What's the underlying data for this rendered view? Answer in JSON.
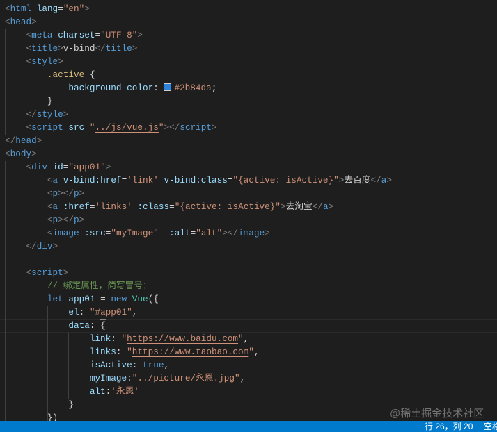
{
  "editor": {
    "current_line": 25,
    "color_swatch": "#2b84da",
    "lines": [
      [
        [
          "p",
          "<"
        ],
        [
          "t",
          "html"
        ],
        [
          "tx",
          " "
        ],
        [
          "a",
          "lang"
        ],
        [
          "tx",
          "="
        ],
        [
          "s",
          "\"en\""
        ],
        [
          "p",
          ">"
        ]
      ],
      [
        [
          "p",
          "<"
        ],
        [
          "t",
          "head"
        ],
        [
          "p",
          ">"
        ]
      ],
      [
        [
          "tx",
          "    "
        ],
        [
          "p",
          "<"
        ],
        [
          "t",
          "meta"
        ],
        [
          "tx",
          " "
        ],
        [
          "a",
          "charset"
        ],
        [
          "tx",
          "="
        ],
        [
          "s",
          "\"UTF-8\""
        ],
        [
          "p",
          ">"
        ]
      ],
      [
        [
          "tx",
          "    "
        ],
        [
          "p",
          "<"
        ],
        [
          "t",
          "title"
        ],
        [
          "p",
          ">"
        ],
        [
          "tx",
          "v-bind"
        ],
        [
          "p",
          "</"
        ],
        [
          "t",
          "title"
        ],
        [
          "p",
          ">"
        ]
      ],
      [
        [
          "tx",
          "    "
        ],
        [
          "p",
          "<"
        ],
        [
          "t",
          "style"
        ],
        [
          "p",
          ">"
        ]
      ],
      [
        [
          "tx",
          "        "
        ],
        [
          "sel",
          ".active"
        ],
        [
          "tx",
          " {"
        ]
      ],
      [
        [
          "tx",
          "            "
        ],
        [
          "a",
          "background-color"
        ],
        [
          "tx",
          ": "
        ],
        [
          "sw",
          ""
        ],
        [
          "s",
          "#2b84da"
        ],
        [
          "tx",
          ";"
        ]
      ],
      [
        [
          "tx",
          "        }"
        ]
      ],
      [
        [
          "tx",
          "    "
        ],
        [
          "p",
          "</"
        ],
        [
          "t",
          "style"
        ],
        [
          "p",
          ">"
        ]
      ],
      [
        [
          "tx",
          "    "
        ],
        [
          "p",
          "<"
        ],
        [
          "t",
          "script"
        ],
        [
          "tx",
          " "
        ],
        [
          "a",
          "src"
        ],
        [
          "tx",
          "="
        ],
        [
          "s",
          "\""
        ],
        [
          "u",
          "../js/vue.js"
        ],
        [
          "s",
          "\""
        ],
        [
          "p",
          "></"
        ],
        [
          "t",
          "script"
        ],
        [
          "p",
          ">"
        ]
      ],
      [
        [
          "p",
          "</"
        ],
        [
          "t",
          "head"
        ],
        [
          "p",
          ">"
        ]
      ],
      [
        [
          "p",
          "<"
        ],
        [
          "t",
          "body"
        ],
        [
          "p",
          ">"
        ]
      ],
      [
        [
          "tx",
          "    "
        ],
        [
          "p",
          "<"
        ],
        [
          "t",
          "div"
        ],
        [
          "tx",
          " "
        ],
        [
          "a",
          "id"
        ],
        [
          "tx",
          "="
        ],
        [
          "s",
          "\"app01\""
        ],
        [
          "p",
          ">"
        ]
      ],
      [
        [
          "tx",
          "        "
        ],
        [
          "p",
          "<"
        ],
        [
          "t",
          "a"
        ],
        [
          "tx",
          " "
        ],
        [
          "a",
          "v-bind:href"
        ],
        [
          "tx",
          "="
        ],
        [
          "s",
          "'link'"
        ],
        [
          "tx",
          " "
        ],
        [
          "a",
          "v-bind:class"
        ],
        [
          "tx",
          "="
        ],
        [
          "s",
          "\"{active: isActive}\""
        ],
        [
          "p",
          ">"
        ],
        [
          "tx",
          "去百度"
        ],
        [
          "p",
          "</"
        ],
        [
          "t",
          "a"
        ],
        [
          "p",
          ">"
        ]
      ],
      [
        [
          "tx",
          "        "
        ],
        [
          "p",
          "<"
        ],
        [
          "t",
          "p"
        ],
        [
          "p",
          "></"
        ],
        [
          "t",
          "p"
        ],
        [
          "p",
          ">"
        ]
      ],
      [
        [
          "tx",
          "        "
        ],
        [
          "p",
          "<"
        ],
        [
          "t",
          "a"
        ],
        [
          "tx",
          " "
        ],
        [
          "a",
          ":href"
        ],
        [
          "tx",
          "="
        ],
        [
          "s",
          "'links'"
        ],
        [
          "tx",
          " "
        ],
        [
          "a",
          ":class"
        ],
        [
          "tx",
          "="
        ],
        [
          "s",
          "\"{active: isActive}\""
        ],
        [
          "p",
          ">"
        ],
        [
          "tx",
          "去淘宝"
        ],
        [
          "p",
          "</"
        ],
        [
          "t",
          "a"
        ],
        [
          "p",
          ">"
        ]
      ],
      [
        [
          "tx",
          "        "
        ],
        [
          "p",
          "<"
        ],
        [
          "t",
          "p"
        ],
        [
          "p",
          "></"
        ],
        [
          "t",
          "p"
        ],
        [
          "p",
          ">"
        ]
      ],
      [
        [
          "tx",
          "        "
        ],
        [
          "p",
          "<"
        ],
        [
          "t",
          "image"
        ],
        [
          "tx",
          " "
        ],
        [
          "a",
          ":src"
        ],
        [
          "tx",
          "="
        ],
        [
          "s",
          "\"myImage\""
        ],
        [
          "tx",
          "  "
        ],
        [
          "a",
          ":alt"
        ],
        [
          "tx",
          "="
        ],
        [
          "s",
          "\"alt\""
        ],
        [
          "p",
          "></"
        ],
        [
          "t",
          "image"
        ],
        [
          "p",
          ">"
        ]
      ],
      [
        [
          "tx",
          "    "
        ],
        [
          "p",
          "</"
        ],
        [
          "t",
          "div"
        ],
        [
          "p",
          ">"
        ]
      ],
      [],
      [
        [
          "tx",
          "    "
        ],
        [
          "p",
          "<"
        ],
        [
          "t",
          "script"
        ],
        [
          "p",
          ">"
        ]
      ],
      [
        [
          "tx",
          "        "
        ],
        [
          "c",
          "// 绑定属性，简写冒号："
        ]
      ],
      [
        [
          "tx",
          "        "
        ],
        [
          "k",
          "let"
        ],
        [
          "tx",
          " "
        ],
        [
          "a",
          "app01"
        ],
        [
          "tx",
          " = "
        ],
        [
          "k",
          "new"
        ],
        [
          "tx",
          " "
        ],
        [
          "cl",
          "Vue"
        ],
        [
          "tx",
          "({"
        ]
      ],
      [
        [
          "tx",
          "            "
        ],
        [
          "a",
          "el"
        ],
        [
          "tx",
          ": "
        ],
        [
          "s",
          "\"#app01\""
        ],
        [
          "tx",
          ","
        ]
      ],
      [
        [
          "tx",
          "            "
        ],
        [
          "a",
          "data"
        ],
        [
          "tx",
          ": "
        ],
        [
          "br",
          "{"
        ]
      ],
      [
        [
          "tx",
          "                "
        ],
        [
          "a",
          "link"
        ],
        [
          "tx",
          ": "
        ],
        [
          "s",
          "\""
        ],
        [
          "u",
          "https://www.baidu.com"
        ],
        [
          "s",
          "\""
        ],
        [
          "tx",
          ","
        ]
      ],
      [
        [
          "tx",
          "                "
        ],
        [
          "a",
          "links"
        ],
        [
          "tx",
          ": "
        ],
        [
          "s",
          "\""
        ],
        [
          "u",
          "https://www.taobao.com"
        ],
        [
          "s",
          "\""
        ],
        [
          "tx",
          ","
        ]
      ],
      [
        [
          "tx",
          "                "
        ],
        [
          "a",
          "isActive"
        ],
        [
          "tx",
          ": "
        ],
        [
          "k",
          "true"
        ],
        [
          "tx",
          ","
        ]
      ],
      [
        [
          "tx",
          "                "
        ],
        [
          "a",
          "myImage"
        ],
        [
          "tx",
          ":"
        ],
        [
          "s",
          "\"../picture/永恩.jpg\""
        ],
        [
          "tx",
          ","
        ]
      ],
      [
        [
          "tx",
          "                "
        ],
        [
          "a",
          "alt"
        ],
        [
          "tx",
          ":"
        ],
        [
          "s",
          "'永恩'"
        ]
      ],
      [
        [
          "tx",
          "            "
        ],
        [
          "br",
          "}"
        ]
      ],
      [
        [
          "tx",
          "        })"
        ]
      ]
    ]
  },
  "status": {
    "position": "行 26，列 20",
    "indent": "空格"
  },
  "watermark": "@稀土掘金技术社区"
}
